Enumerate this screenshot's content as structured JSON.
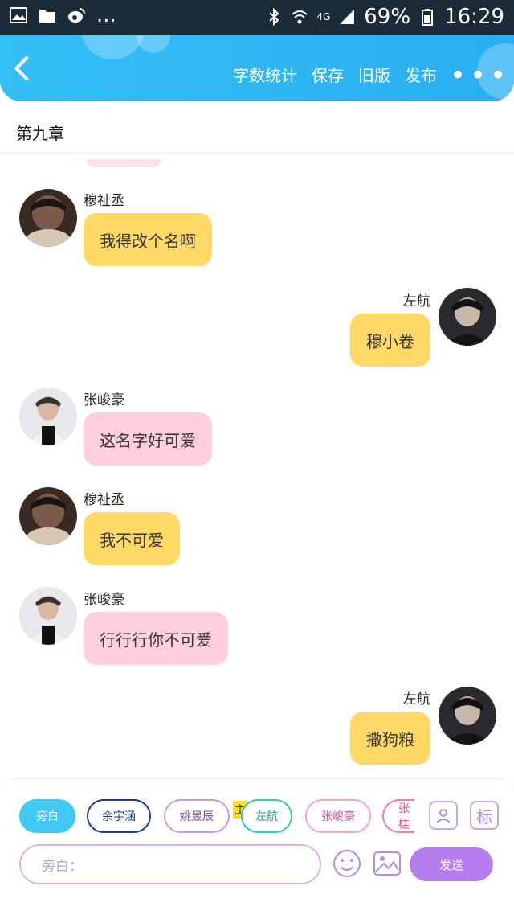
{
  "status_bar": {
    "battery": "69%",
    "time": "16:29",
    "network": "4G",
    "more_dots": "..."
  },
  "header": {
    "actions": [
      "字数统计",
      "保存",
      "旧版",
      "发布"
    ],
    "more": "•••"
  },
  "chapter_title": "第九章",
  "messages": [
    {
      "side": "left",
      "name": "穆祉丞",
      "text": "我得改个名啊",
      "color": "#ffd866"
    },
    {
      "side": "right",
      "name": "左航",
      "text": "穆小卷",
      "color": "#ffd866"
    },
    {
      "side": "left",
      "name": "张峻豪",
      "text": "这名字好可爱",
      "color": "#ffcfe0"
    },
    {
      "side": "left",
      "name": "穆祉丞",
      "text": "我不可爱",
      "color": "#ffd866"
    },
    {
      "side": "left",
      "name": "张峻豪",
      "text": "行行行你不可爱",
      "color": "#ffcfe0"
    },
    {
      "side": "right",
      "name": "左航",
      "text": "撒狗粮",
      "color": "#ffd866"
    }
  ],
  "characters": [
    {
      "label": "旁白",
      "active": true
    },
    {
      "label": "余宇涵",
      "active": false
    },
    {
      "label": "姚昱辰",
      "active": false
    },
    {
      "label": "左航",
      "active": false
    },
    {
      "label": "张峻豪",
      "active": false
    },
    {
      "label": "张桂",
      "active": false
    }
  ],
  "main_badge": "主",
  "tool_buttons": {
    "role_icon": "person-card-icon",
    "tag_label": "标"
  },
  "input": {
    "placeholder": "旁白："
  },
  "send_label": "发送"
}
